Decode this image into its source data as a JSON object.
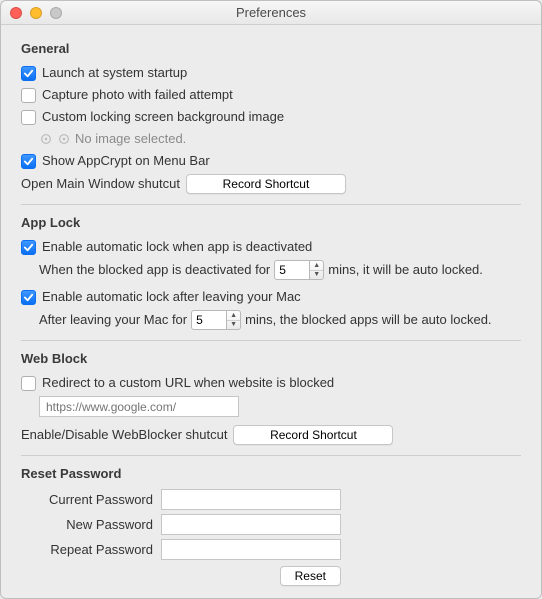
{
  "window": {
    "title": "Preferences"
  },
  "general": {
    "heading": "General",
    "launch_checked": true,
    "launch_label": "Launch at system startup",
    "capture_checked": false,
    "capture_label": "Capture photo with failed attempt",
    "custom_lock_checked": false,
    "custom_lock_label": "Custom locking screen background image",
    "no_image_label": "No image selected.",
    "menubar_checked": true,
    "menubar_label": "Show AppCrypt on Menu Bar",
    "open_main_label": "Open Main Window shutcut",
    "record_shortcut_label": "Record Shortcut"
  },
  "applock": {
    "heading": "App Lock",
    "deact_checked": true,
    "deact_label": "Enable automatic lock when app is deactivated",
    "deact_sub_prefix": "When the blocked app is deactivated for",
    "deact_value": "5",
    "deact_sub_suffix": "mins, it will be auto locked.",
    "leave_checked": true,
    "leave_label": "Enable automatic lock after leaving your Mac",
    "leave_sub_prefix": "After leaving your Mac for",
    "leave_value": "5",
    "leave_sub_suffix": "mins, the blocked apps will be auto locked."
  },
  "webblock": {
    "heading": "Web Block",
    "redirect_checked": false,
    "redirect_label": "Redirect to a custom URL when website is blocked",
    "redirect_placeholder": "https://www.google.com/",
    "shortcut_label": "Enable/Disable WebBlocker shutcut",
    "record_shortcut_label": "Record Shortcut"
  },
  "reset": {
    "heading": "Reset Password",
    "current_label": "Current Password",
    "new_label": "New Password",
    "repeat_label": "Repeat Password",
    "button_label": "Reset"
  }
}
